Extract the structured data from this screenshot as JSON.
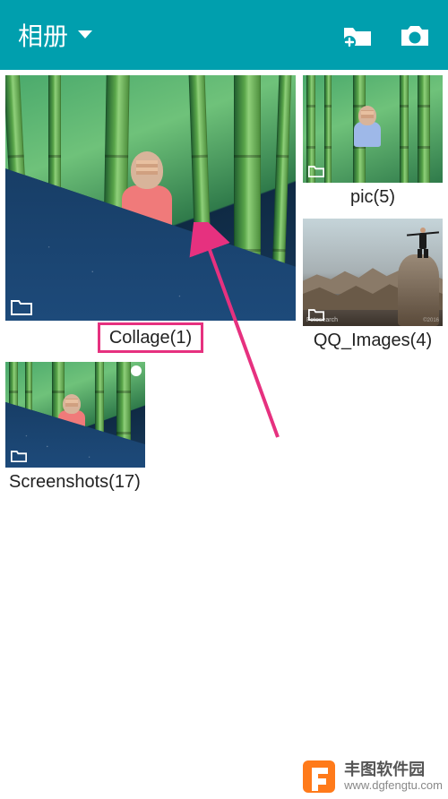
{
  "topbar": {
    "title": "相册",
    "new_folder_icon": "new-folder",
    "camera_icon": "camera"
  },
  "albums": {
    "collage": {
      "label": "Collage(1)"
    },
    "pic": {
      "label": "pic(5)"
    },
    "qq": {
      "label": "QQ_Images(4)"
    },
    "screenshots": {
      "label": "Screenshots(17)"
    }
  },
  "footer": {
    "name": "丰图软件园",
    "url": "www.dgfengtu.com"
  }
}
